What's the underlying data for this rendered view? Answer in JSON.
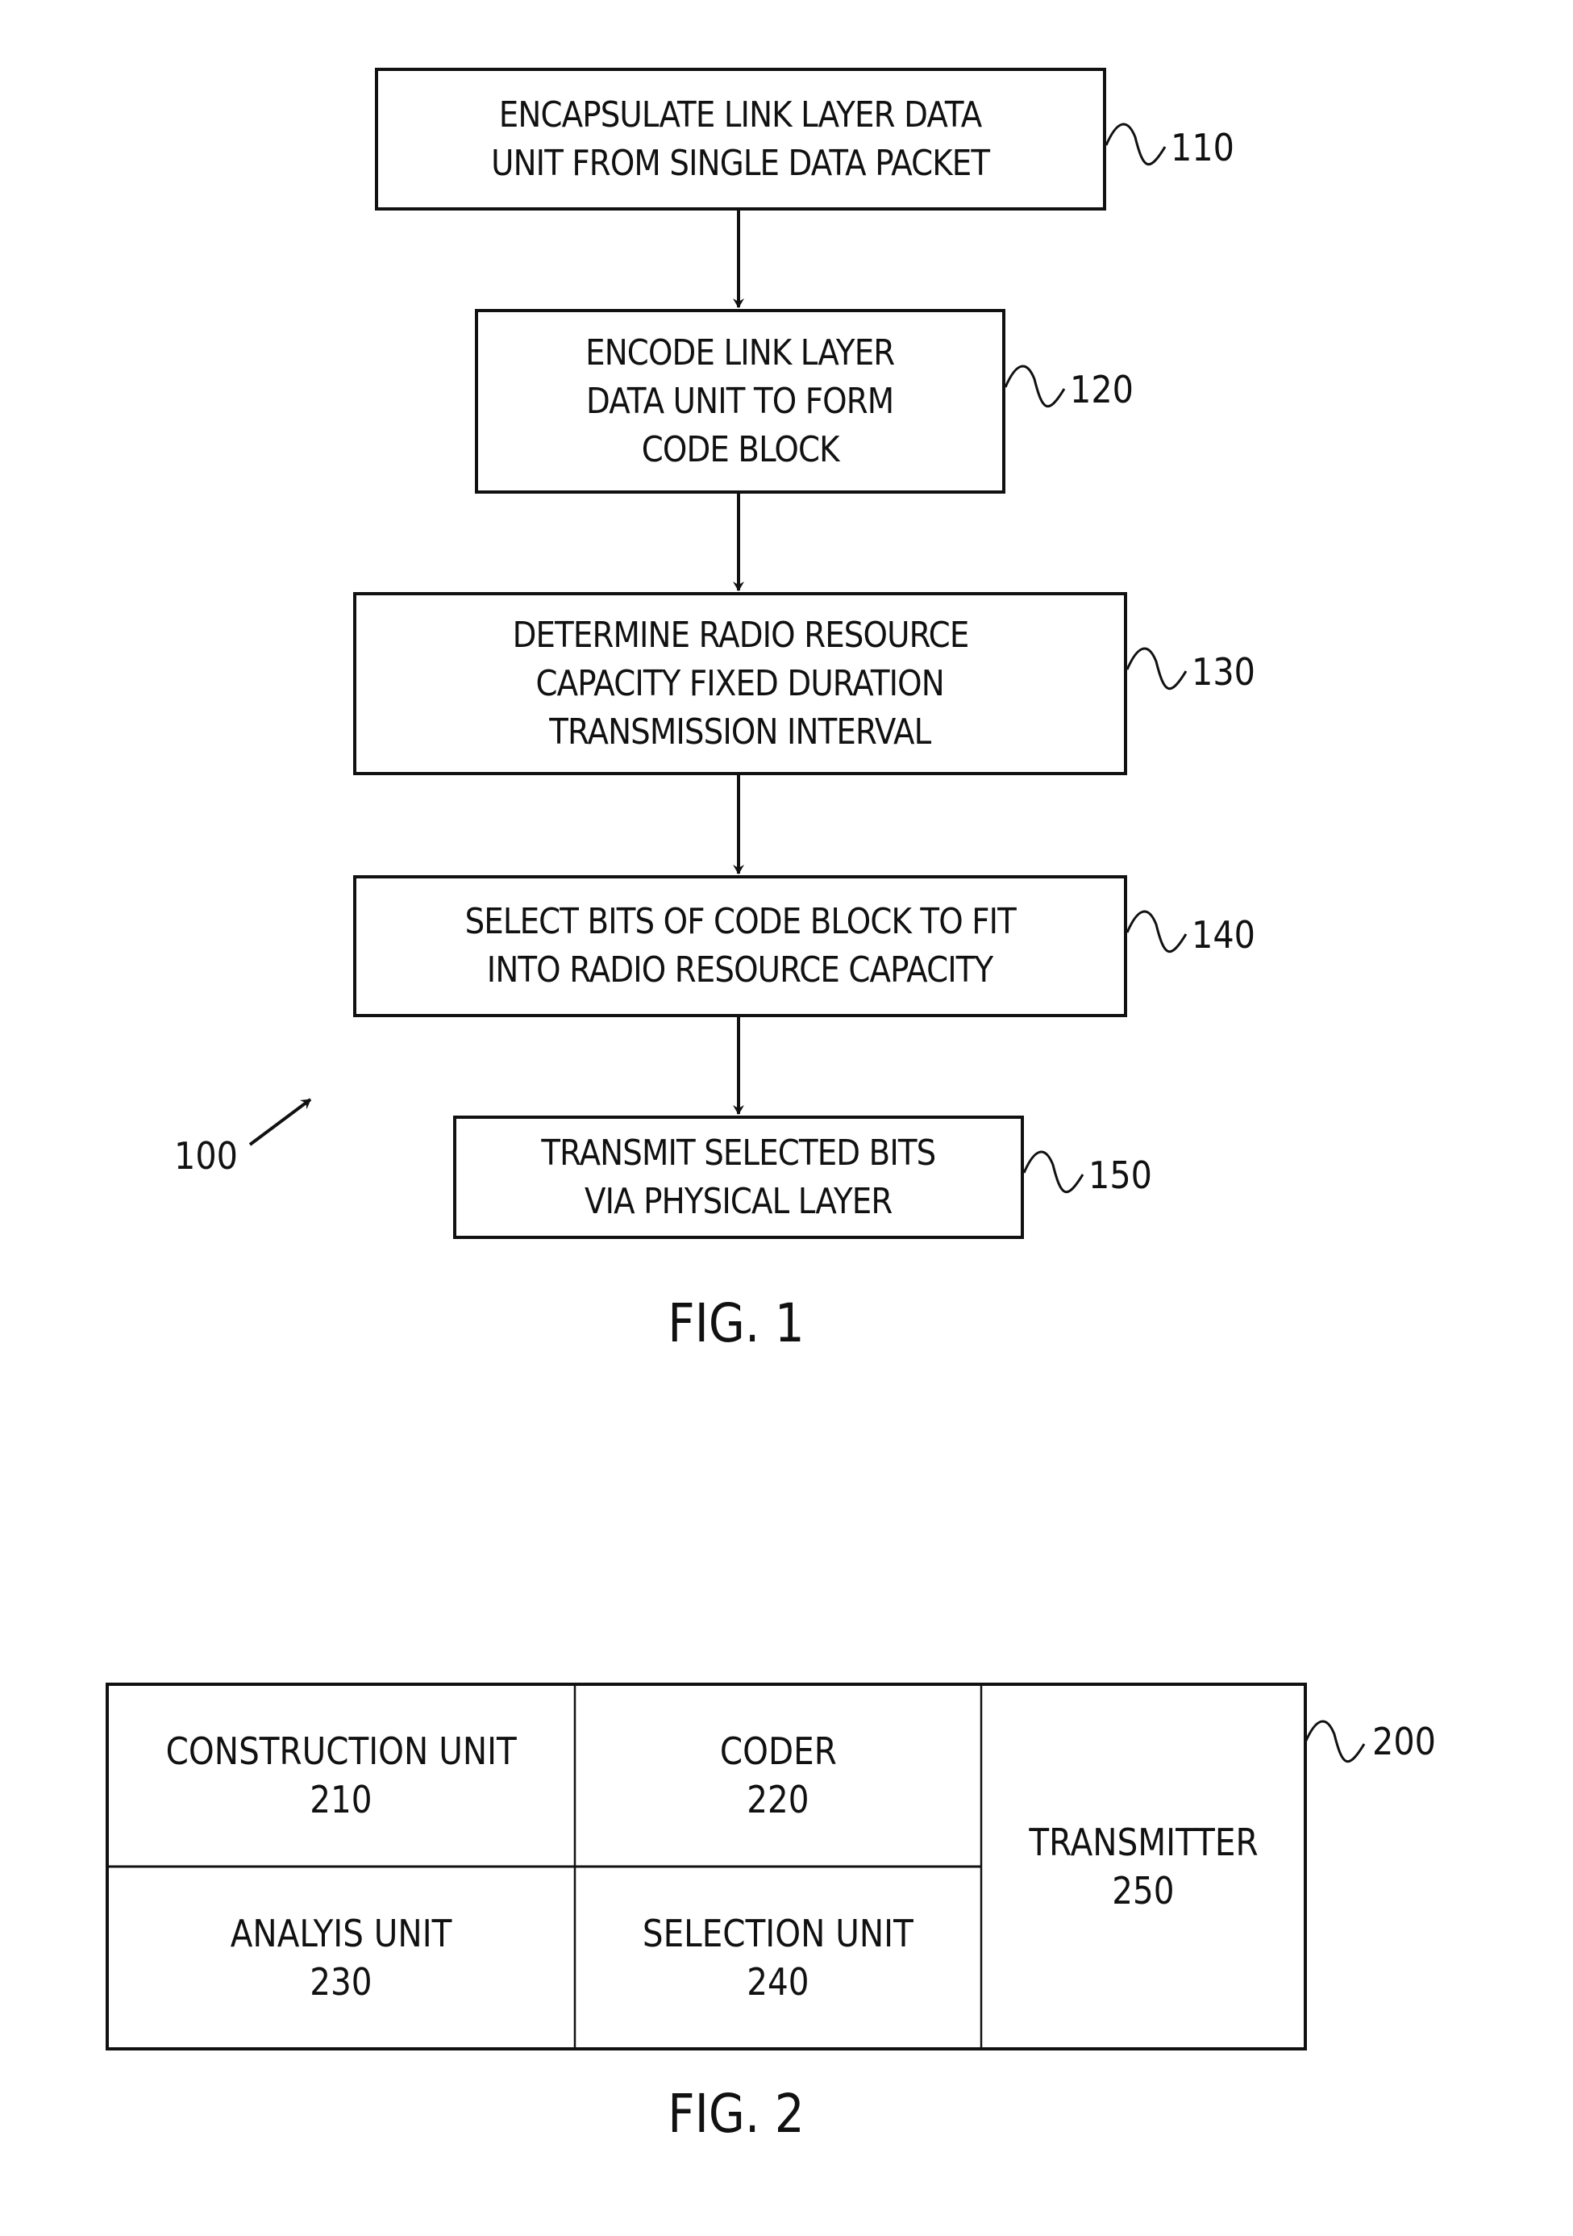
{
  "fig1": {
    "caption": "FIG. 1",
    "reference": "100",
    "steps": [
      {
        "ref": "110",
        "lines": [
          "ENCAPSULATE LINK LAYER DATA",
          "UNIT FROM SINGLE DATA PACKET"
        ]
      },
      {
        "ref": "120",
        "lines": [
          "ENCODE LINK LAYER",
          "DATA UNIT TO FORM",
          "CODE BLOCK"
        ]
      },
      {
        "ref": "130",
        "lines": [
          "DETERMINE RADIO RESOURCE",
          "CAPACITY FIXED DURATION",
          "TRANSMISSION INTERVAL"
        ]
      },
      {
        "ref": "140",
        "lines": [
          "SELECT BITS OF CODE BLOCK TO FIT",
          "INTO RADIO RESOURCE CAPACITY"
        ]
      },
      {
        "ref": "150",
        "lines": [
          "TRANSMIT SELECTED BITS",
          "VIA PHYSICAL LAYER"
        ]
      }
    ]
  },
  "fig2": {
    "caption": "FIG. 2",
    "reference": "200",
    "units": [
      {
        "name": "CONSTRUCTION UNIT",
        "ref": "210"
      },
      {
        "name": "CODER",
        "ref": "220"
      },
      {
        "name": "ANALYIS UNIT",
        "ref": "230"
      },
      {
        "name": "SELECTION UNIT",
        "ref": "240"
      },
      {
        "name": "TRANSMITTER",
        "ref": "250"
      }
    ]
  }
}
